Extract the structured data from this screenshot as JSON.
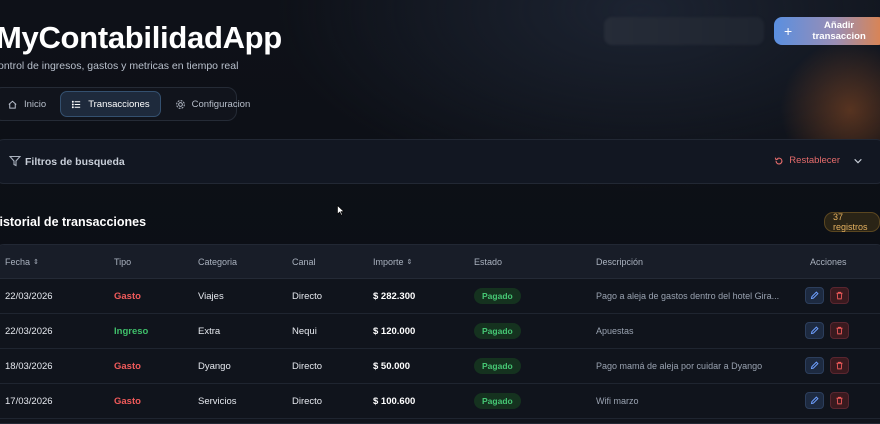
{
  "header": {
    "title": "MyContabilidadApp",
    "subtitle": "ontrol de ingresos, gastos y metricas en tiempo real",
    "add_button_label": "Añadir transaccion"
  },
  "nav": {
    "tabs": [
      {
        "label": "Inicio",
        "icon": "home-icon"
      },
      {
        "label": "Transacciones",
        "icon": "list-icon",
        "active": true
      },
      {
        "label": "Configuracion",
        "icon": "gear-icon"
      }
    ]
  },
  "filters": {
    "title": "Filtros de busqueda",
    "reset_label": "Restablecer"
  },
  "history": {
    "title": "listorial de transacciones",
    "count_label": "37 registros"
  },
  "table": {
    "columns": [
      "Fecha",
      "Tipo",
      "Categoria",
      "Canal",
      "Importe",
      "Estado",
      "Descripción",
      "Acciones"
    ],
    "rows": [
      {
        "fecha": "22/03/2026",
        "tipo": "Gasto",
        "categoria": "Viajes",
        "canal": "Directo",
        "importe": "$ 282.300",
        "estado": "Pagado",
        "descripcion": "Pago a aleja de gastos dentro del hotel Gira..."
      },
      {
        "fecha": "22/03/2026",
        "tipo": "Ingreso",
        "categoria": "Extra",
        "canal": "Nequi",
        "importe": "$ 120.000",
        "estado": "Pagado",
        "descripcion": "Apuestas"
      },
      {
        "fecha": "18/03/2026",
        "tipo": "Gasto",
        "categoria": "Dyango",
        "canal": "Directo",
        "importe": "$ 50.000",
        "estado": "Pagado",
        "descripcion": "Pago mamá de aleja por cuidar a Dyango"
      },
      {
        "fecha": "17/03/2026",
        "tipo": "Gasto",
        "categoria": "Servicios",
        "canal": "Directo",
        "importe": "$ 100.600",
        "estado": "Pagado",
        "descripcion": "Wifi marzo"
      }
    ]
  },
  "colors": {
    "gasto": "#ef5a5a",
    "ingreso": "#3fbf6a",
    "pagado": "#46c774",
    "accent_blue": "#5a8fe0",
    "accent_orange": "#e0834a"
  }
}
